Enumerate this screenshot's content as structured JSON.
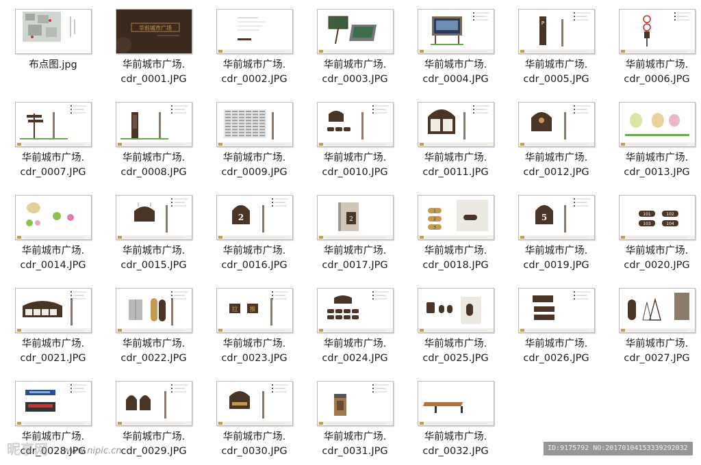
{
  "files": [
    {
      "name": "布点图.jpg",
      "thumb": "site-plan"
    },
    {
      "name": "华前城市广场.\ncdr_0001.JPG",
      "thumb": "cover"
    },
    {
      "name": "华前城市广场.\ncdr_0002.JPG",
      "thumb": "text-page"
    },
    {
      "name": "华前城市广场.\ncdr_0003.JPG",
      "thumb": "billboard-3d"
    },
    {
      "name": "华前城市广场.\ncdr_0004.JPG",
      "thumb": "billboard-frame"
    },
    {
      "name": "华前城市广场.\ncdr_0005.JPG",
      "thumb": "parking-pole"
    },
    {
      "name": "华前城市广场.\ncdr_0006.JPG",
      "thumb": "traffic-sign"
    },
    {
      "name": "华前城市广场.\ncdr_0007.JPG",
      "thumb": "direction-post"
    },
    {
      "name": "华前城市广场.\ncdr_0008.JPG",
      "thumb": "totem-pole"
    },
    {
      "name": "华前城市广场.\ncdr_0009.JPG",
      "thumb": "directory-board"
    },
    {
      "name": "华前城市广场.\ncdr_0010.JPG",
      "thumb": "plaque-set"
    },
    {
      "name": "华前城市广场.\ncdr_0011.JPG",
      "thumb": "notice-board"
    },
    {
      "name": "华前城市广场.\ncdr_0012.JPG",
      "thumb": "door-plaque"
    },
    {
      "name": "华前城市广场.\ncdr_0013.JPG",
      "thumb": "lawn-signs"
    },
    {
      "name": "华前城市广场.\ncdr_0014.JPG",
      "thumb": "flower-signs"
    },
    {
      "name": "华前城市广场.\ncdr_0015.JPG",
      "thumb": "hanging-plaque"
    },
    {
      "name": "华前城市广场.\ncdr_0016.JPG",
      "thumb": "floor-2"
    },
    {
      "name": "华前城市广场.\ncdr_0017.JPG",
      "thumb": "wall-floor-2"
    },
    {
      "name": "华前城市广场.\ncdr_0018.JPG",
      "thumb": "floor-tags"
    },
    {
      "name": "华前城市广场.\ncdr_0019.JPG",
      "thumb": "floor-5"
    },
    {
      "name": "华前城市广场.\ncdr_0020.JPG",
      "thumb": "room-numbers"
    },
    {
      "name": "华前城市广场.\ncdr_0021.JPG",
      "thumb": "wide-board"
    },
    {
      "name": "华前城市广场.\ncdr_0022.JPG",
      "thumb": "elevator"
    },
    {
      "name": "华前城市广场.\ncdr_0023.JPG",
      "thumb": "push-pull"
    },
    {
      "name": "华前城市广场.\ncdr_0024.JPG",
      "thumb": "small-plaques"
    },
    {
      "name": "华前城市广场.\ncdr_0025.JPG",
      "thumb": "restroom"
    },
    {
      "name": "华前城市广场.\ncdr_0026.JPG",
      "thumb": "office-signs"
    },
    {
      "name": "华前城市广场.\ncdr_0027.JPG",
      "thumb": "a-frame"
    },
    {
      "name": "华前城市广场.\ncdr_0028.JPG",
      "thumb": "led-screens"
    },
    {
      "name": "华前城市广场.\ncdr_0029.JPG",
      "thumb": "double-panels"
    },
    {
      "name": "华前城市广场.\ncdr_0030.JPG",
      "thumb": "account-plaque"
    },
    {
      "name": "华前城市广场.\ncdr_0031.JPG",
      "thumb": "trash-bin"
    },
    {
      "name": "华前城市广场.\ncdr_0032.JPG",
      "thumb": "bench"
    }
  ],
  "thumb_text": {
    "cover_title": "华前城市广场",
    "floor_2": "2",
    "floor_5": "5",
    "pull": "拉",
    "push": "推",
    "rooms": [
      "101",
      "102",
      "103",
      "104"
    ],
    "tags": [
      "1",
      "2",
      "3"
    ]
  },
  "colors": {
    "brand_brown": "#4a3426",
    "gold": "#c49a52",
    "frame_border": "#b9b9b9",
    "green_grass": "#6aa84f"
  },
  "watermark": {
    "logo": "昵享网",
    "url": "www.nipic.cn",
    "id_text": "ID:9175792 NO:20170104153339292032"
  }
}
